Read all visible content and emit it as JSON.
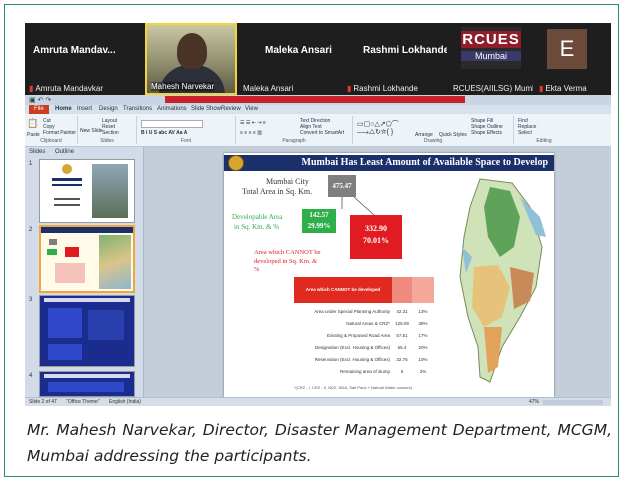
{
  "participants": [
    {
      "name": "Amruta  Mandav...",
      "label": "Amruta Mandavkar",
      "muted": true
    },
    {
      "name": "",
      "label": "Mahesh Narvekar",
      "muted": false,
      "video": true
    },
    {
      "name": "Maleka Ansari",
      "label": "Maleka Ansari",
      "muted": false
    },
    {
      "name": "Rashmi Lokhande",
      "label": "Rashmi Lokhande",
      "muted": true
    },
    {
      "name": "",
      "label": "RCUES(AIILSG) Mumbai",
      "muted": false,
      "logo_top": "RCUES",
      "logo_sub": "Mumbai"
    },
    {
      "name": "",
      "label": "Ekta Verma",
      "muted": true,
      "initial": "E"
    }
  ],
  "ppt": {
    "tabs": [
      "File",
      "Home",
      "Insert",
      "Design",
      "Transitions",
      "Animations",
      "Slide Show",
      "Review",
      "View"
    ],
    "groups": [
      "Clipboard",
      "Slides",
      "Font",
      "Paragraph",
      "Drawing",
      "Editing"
    ],
    "ribbon_items": [
      "Cut",
      "Copy",
      "Format Painter",
      "Paste",
      "New Slide",
      "Layout",
      "Reset",
      "Section",
      "Text Direction",
      "Align Text",
      "Convert to SmartArt",
      "Arrange",
      "Quick Styles",
      "Shape Fill",
      "Shape Outline",
      "Shape Effects",
      "Find",
      "Replace",
      "Select"
    ],
    "pane_tabs": [
      "Slides",
      "Outline"
    ],
    "thumb_numbers": [
      "1",
      "2",
      "3",
      "4"
    ],
    "status": "Slide 2 of 47",
    "theme": "\"Office Theme\"",
    "language": "English (India)",
    "zoom": "47%"
  },
  "slide": {
    "title": "Mumbai Has Least Amount of Available Space to Develop",
    "city_label_1": "Mumbai City",
    "city_label_2": "Total Area in Sq. Km.",
    "total_area": "475.47",
    "dev_label_1": "Developable Area",
    "dev_label_2": "in Sq. Km. & %",
    "dev_area": "142.57",
    "dev_pct": "29.99%",
    "cannot_label_1": "Area which CANNOT be",
    "cannot_label_2": "developed in Sq. Km. &",
    "cannot_label_3": "%",
    "cannot_area": "332.90",
    "cannot_pct": "70.01%",
    "table_header": "Area which CANNOT be developed",
    "table_rows": [
      {
        "label": "Area under Special Planning Authority",
        "v1": "42.31",
        "v2": "13%"
      },
      {
        "label": "Natural Areas & CRZ*",
        "v1": "128.09",
        "v2": "38%"
      },
      {
        "label": "Existing & Proposed Road Area",
        "v1": "57.51",
        "v2": "17%"
      },
      {
        "label": "Designation (Excl. Housing & Offices)",
        "v1": "65.4",
        "v2": "20%"
      },
      {
        "label": "Reservation (Excl. Housing & Offices)",
        "v1": "32.75",
        "v2": "10%"
      },
      {
        "label": "Remaining area of slump",
        "v1": "6",
        "v2": "2%"
      }
    ],
    "footnote": "*(CRZ - I, CRZ - II, NDZ, NDA, Salt Pans + Natural Water courses)"
  },
  "caption": "Mr. Mahesh Narvekar, Director, Disaster Management Department, MCGM, Mumbai addressing the participants.",
  "colors": {
    "frame": "#2f8a6a",
    "title_bar": "#1b2f6b",
    "green_box": "#2fae4a",
    "red_box": "#e11b22",
    "gray_box": "#7f7f7f"
  }
}
